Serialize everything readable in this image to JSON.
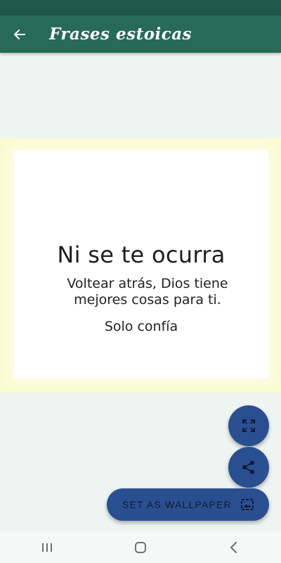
{
  "app_bar": {
    "title": "Frases estoicas",
    "back_icon": "arrow-left-icon"
  },
  "image": {
    "heading": "Ni se te ocurra",
    "body": "Voltear atrás, Dios tiene mejores cosas para ti.",
    "sign": "Solo confía"
  },
  "actions": {
    "fullscreen_icon": "fullscreen-icon",
    "share_icon": "share-icon",
    "wallpaper_label": "SET AS WALLPAPER",
    "wallpaper_icon": "wallpaper-icon"
  },
  "nav": {
    "recents_icon": "recents-icon",
    "home_icon": "home-icon",
    "back_icon": "back-icon"
  },
  "colors": {
    "app_bar": "#276a55",
    "status_bar": "#1f5848",
    "fab": "#2a4f91",
    "background": "#eef4f1",
    "image_border": "#f8fbcf"
  }
}
